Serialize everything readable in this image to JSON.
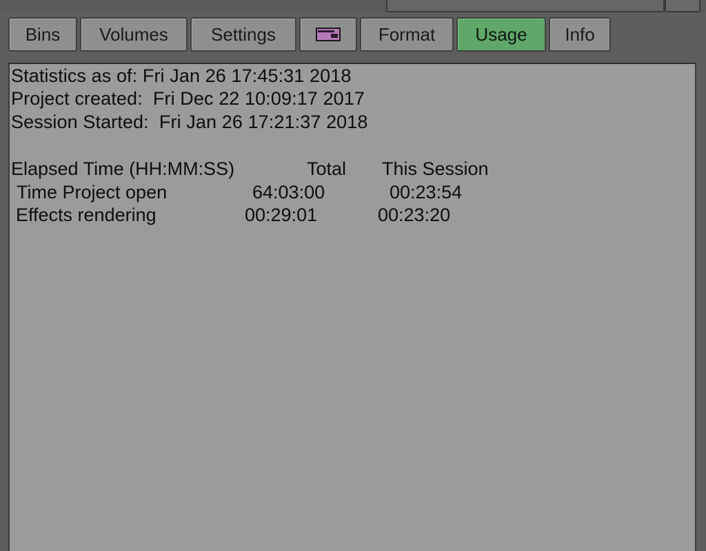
{
  "tabs": [
    {
      "label": "Bins"
    },
    {
      "label": "Volumes"
    },
    {
      "label": "Settings"
    },
    {
      "label": ""
    },
    {
      "label": "Format"
    },
    {
      "label": "Usage"
    },
    {
      "label": "Info"
    }
  ],
  "active_tab": "Usage",
  "stats": {
    "statistics_as_of": "Statistics as of: Fri Jan 26 17:45:31 2018",
    "project_created": "Project created:  Fri Dec 22 10:09:17 2017",
    "session_started": "Session Started:  Fri Jan 26 17:21:37 2018"
  },
  "elapsed": {
    "header": {
      "label": "Elapsed Time (HH:MM:SS)",
      "total": "Total",
      "session": "This Session"
    },
    "rows": [
      {
        "label": "Time Project open",
        "total": "64:03:00",
        "session": "00:23:54"
      },
      {
        "label": "Effects rendering",
        "total": "00:29:01",
        "session": "00:23:20"
      }
    ]
  },
  "colors": {
    "active_tab": "#5fa86a",
    "panel_bg": "#9b9b9b",
    "tab_bg": "#8f8f8f",
    "strip_icon": "#b77ab8"
  }
}
